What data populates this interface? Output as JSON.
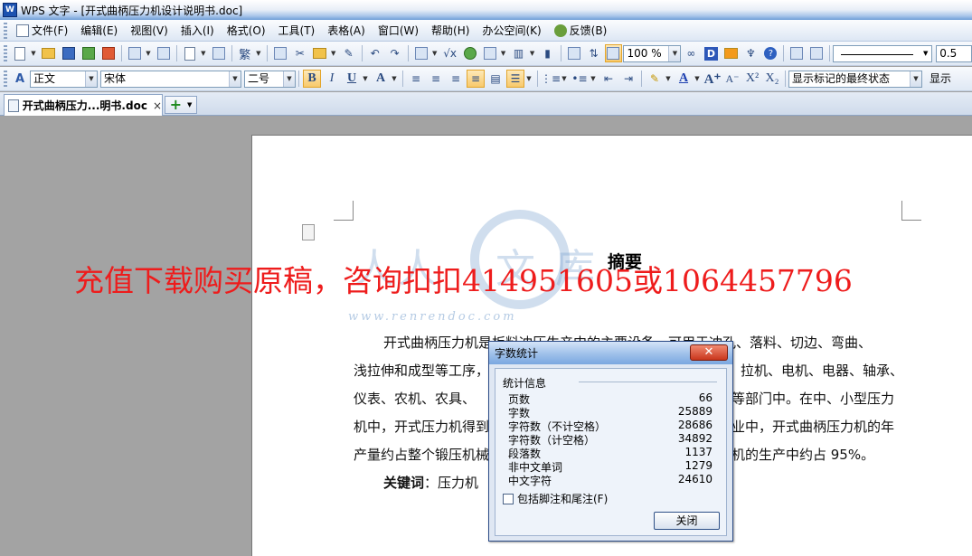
{
  "window": {
    "app_logo": "W",
    "title": "WPS 文字 - [开式曲柄压力机设计说明书.doc]"
  },
  "menu": {
    "items": [
      "文件(F)",
      "编辑(E)",
      "视图(V)",
      "插入(I)",
      "格式(O)",
      "工具(T)",
      "表格(A)",
      "窗口(W)",
      "帮助(H)",
      "办公空间(K)",
      "反馈(B)"
    ]
  },
  "toolbar": {
    "zoom": "100 %",
    "dbutton": "D",
    "line_width": "0.5"
  },
  "format_toolbar": {
    "style": "正文",
    "font": "宋体",
    "size": "二号",
    "bold": "B",
    "italic": "I",
    "underline": "U",
    "font_color": "A",
    "superscript": "X²",
    "subscript": "X₂",
    "markup_state": "显示标记的最终状态",
    "show_label": "显示"
  },
  "tabs": {
    "doc_label": "开式曲柄压力...明书.doc",
    "close": "×",
    "new_tab": "+"
  },
  "document": {
    "heading": "摘要",
    "lines": [
      "开式曲柄压力机是板料冲压生产中的主要设备，可用于冲孔、落料、切边、弯曲、",
      "浅拉伸和成型等工序，",
      "仪表、农机、农具、",
      "机中，开式压力机得到",
      "产量约占整个锻压机械",
      "关键词：压力机"
    ],
    "right_fragments": [
      "拉机、电机、电器、轴承、",
      "等部门中。在中、小型压力",
      "业中，开式曲柄压力机的年",
      "机的生产中约占 95%。"
    ],
    "keyword_label": "关键词",
    "keyword_rest": "：压力机"
  },
  "watermark": {
    "banner": "充值下载购买原稿，咨询扣扣414951605或1064457796",
    "url": "www.renrendoc.com",
    "chars": [
      "人",
      "人",
      "文",
      "库"
    ]
  },
  "dialog": {
    "title": "字数统计",
    "close": "✕",
    "group": "统计信息",
    "stats": [
      {
        "label": "页数",
        "value": "66"
      },
      {
        "label": "字数",
        "value": "25889"
      },
      {
        "label": "字符数（不计空格）",
        "value": "28686"
      },
      {
        "label": "字符数（计空格）",
        "value": "34892"
      },
      {
        "label": "段落数",
        "value": "1137"
      },
      {
        "label": "非中文单词",
        "value": "1279"
      },
      {
        "label": "中文字符",
        "value": "24610"
      }
    ],
    "checkbox_label": "包括脚注和尾注(F)",
    "ok_label": "关闭"
  },
  "colors": {
    "banner_red": "#ee1c1c",
    "dialog_title": "#9ec0ea",
    "watermark_blue": "#78a0cd"
  }
}
